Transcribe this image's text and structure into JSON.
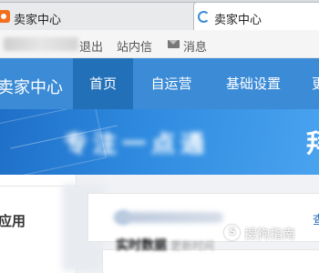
{
  "browser": {
    "tabs": [
      {
        "title": "卖家中心",
        "close_glyph": "×",
        "icon": "taobao-favicon"
      },
      {
        "title": "卖家中心",
        "icon": "loading-spinner"
      }
    ]
  },
  "utility_bar": {
    "logout": "退出",
    "messages": "站内信",
    "notice": "消息",
    "notice_icon": "mail-icon"
  },
  "header": {
    "brand": "卖家中心",
    "nav": [
      {
        "label": "首页",
        "active": true
      },
      {
        "label": "自运营",
        "active": false
      },
      {
        "label": "基础设置",
        "active": false
      },
      {
        "label": "更",
        "active": false
      }
    ],
    "accent_color": "#3b8bd6",
    "active_color": "#2270b8"
  },
  "banner": {
    "blurred_text": "专注一点通",
    "tail_glyph": "拜"
  },
  "sidebar": {
    "title": "应用"
  },
  "notice_card": {
    "link": "查"
  },
  "data_card": {
    "title": "实时数据",
    "meta": "更新时间"
  },
  "watermark": {
    "text": "搜狗指南"
  }
}
